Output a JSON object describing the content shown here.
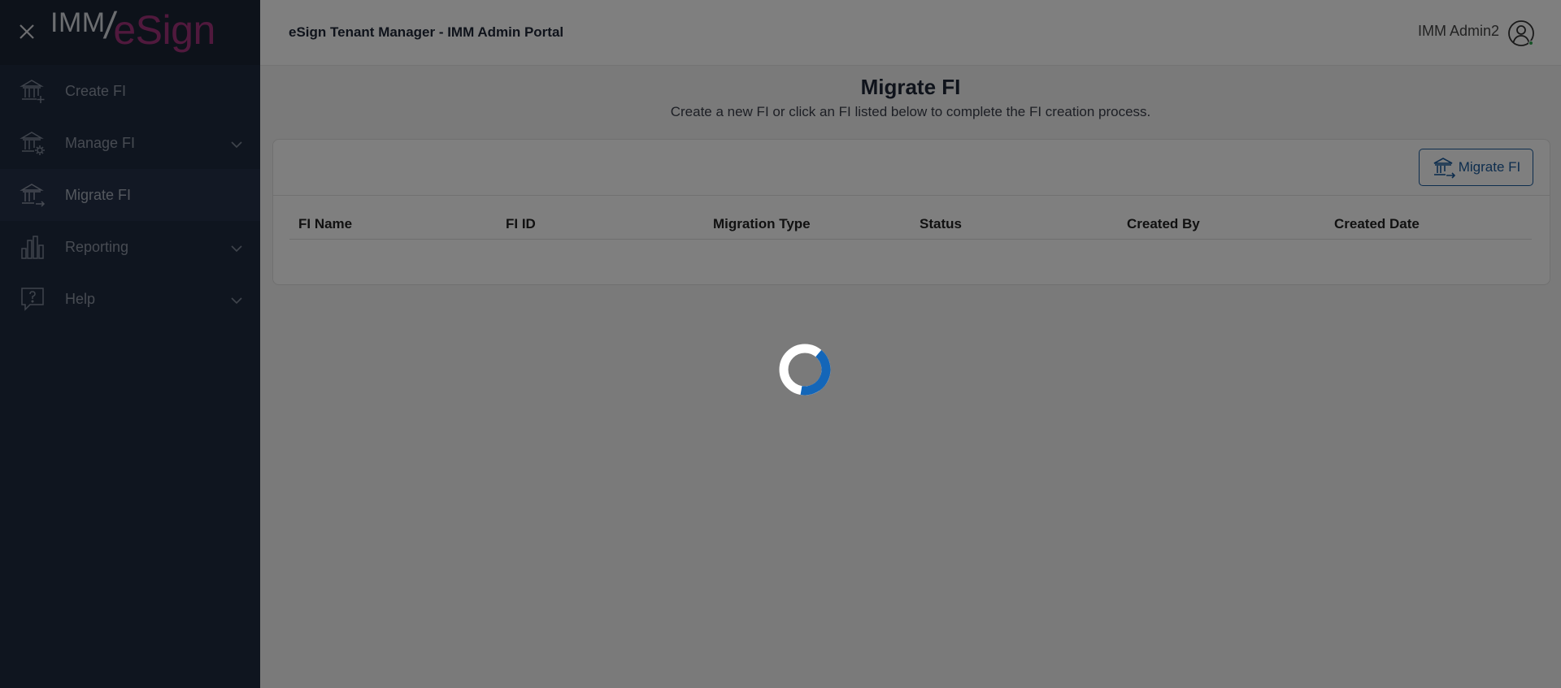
{
  "sidebar": {
    "logo": {
      "part1": "IMM",
      "part2": "eSign"
    },
    "items": [
      {
        "label": "Create FI",
        "icon": "bank-plus-icon"
      },
      {
        "label": "Manage FI",
        "icon": "bank-gear-icon",
        "has_submenu": true
      },
      {
        "label": "Migrate FI",
        "icon": "bank-arrow-icon",
        "active": true
      },
      {
        "label": "Reporting",
        "icon": "bar-chart-icon",
        "has_submenu": true
      },
      {
        "label": "Help",
        "icon": "help-bubble-icon",
        "has_submenu": true
      }
    ]
  },
  "header": {
    "title": "eSign Tenant Manager - IMM Admin Portal",
    "user_name": "IMM Admin2"
  },
  "page": {
    "title": "Migrate FI",
    "subtitle": "Create a new FI or click an FI listed below to complete the FI creation process.",
    "migrate_button_label": "Migrate FI"
  },
  "table": {
    "columns": [
      "FI Name",
      "FI ID",
      "Migration Type",
      "Status",
      "Created By",
      "Created Date"
    ],
    "rows": []
  },
  "colors": {
    "sidebar_bg": "#1e2a3f",
    "accent": "#1a5a9c",
    "logo_magenta": "#a0337a",
    "spinner_accent": "#1466b8"
  },
  "loading": true
}
